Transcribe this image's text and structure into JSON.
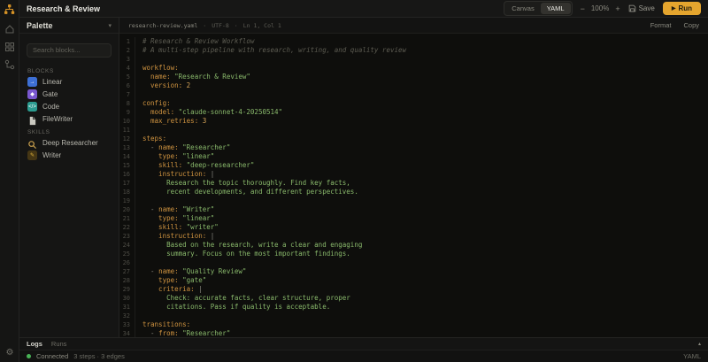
{
  "app": {
    "title": "Research & Review"
  },
  "rail": {
    "icons": [
      "logo-icon",
      "home-icon",
      "blocks-grid-icon",
      "flow-icon",
      "gear-icon"
    ]
  },
  "topbar": {
    "view_canvas": "Canvas",
    "view_yaml": "YAML",
    "active_view": "YAML",
    "zoom_out": "−",
    "zoom_level": "100%",
    "zoom_in": "+",
    "save": "Save",
    "run": "Run"
  },
  "palette": {
    "title": "Palette",
    "search_placeholder": "Search blocks...",
    "sections": [
      {
        "label": "Blocks",
        "items": [
          {
            "label": "Linear",
            "icon": "linear-icon",
            "type": "glyph",
            "glyph": "→",
            "bg": "#3d6fd4",
            "fg": "#ffffff"
          },
          {
            "label": "Gate",
            "icon": "gate-icon",
            "type": "glyph",
            "glyph": "◆",
            "bg": "#7a58cf",
            "fg": "#ffffff"
          },
          {
            "label": "Code",
            "icon": "code-icon",
            "type": "glyph",
            "glyph": "</>",
            "bg": "#2b9b8f",
            "fg": "#ffffff"
          },
          {
            "label": "FileWriter",
            "icon": "file-icon",
            "type": "file",
            "fg": "#c9c8c0"
          }
        ]
      },
      {
        "label": "Skills",
        "items": [
          {
            "label": "Deep Researcher",
            "icon": "magnifier-icon",
            "type": "search",
            "fg": "#c9a04d"
          },
          {
            "label": "Writer",
            "icon": "pencil-icon",
            "type": "glyph",
            "glyph": "✎",
            "bg": "#453614",
            "fg": "#e3b53c"
          }
        ]
      }
    ]
  },
  "editor": {
    "filename": "research-review.yaml",
    "separator": "·",
    "encoding": "UTF-8",
    "cursor": "Ln 1, Col 1",
    "format": "Format",
    "copy": "Copy",
    "lines": [
      [
        [
          "com",
          "# Research & Review Workflow"
        ]
      ],
      [
        [
          "com",
          "# A multi-step pipeline with research, writing, and quality review"
        ]
      ],
      [],
      [
        [
          "key",
          "workflow:"
        ]
      ],
      [
        [
          "key",
          "  name:"
        ],
        [
          "str",
          " \"Research & Review\""
        ]
      ],
      [
        [
          "key",
          "  version:"
        ],
        [
          "num",
          " 2"
        ]
      ],
      [],
      [
        [
          "key",
          "config:"
        ]
      ],
      [
        [
          "key",
          "  model:"
        ],
        [
          "str",
          " \"claude-sonnet-4-20250514\""
        ]
      ],
      [
        [
          "key",
          "  max_retries:"
        ],
        [
          "num",
          " 3"
        ]
      ],
      [],
      [
        [
          "key",
          "steps:"
        ]
      ],
      [
        [
          "pun",
          "  - "
        ],
        [
          "key",
          "name:"
        ],
        [
          "str",
          " \"Researcher\""
        ]
      ],
      [
        [
          "key",
          "    type:"
        ],
        [
          "str",
          " \"linear\""
        ]
      ],
      [
        [
          "key",
          "    skill:"
        ],
        [
          "str",
          " \"deep-researcher\""
        ]
      ],
      [
        [
          "key",
          "    instruction:"
        ],
        [
          "pun",
          " |"
        ]
      ],
      [
        [
          "str",
          "      Research the topic thoroughly. Find key facts,"
        ]
      ],
      [
        [
          "str",
          "      recent developments, and different perspectives."
        ]
      ],
      [],
      [
        [
          "pun",
          "  - "
        ],
        [
          "key",
          "name:"
        ],
        [
          "str",
          " \"Writer\""
        ]
      ],
      [
        [
          "key",
          "    type:"
        ],
        [
          "str",
          " \"linear\""
        ]
      ],
      [
        [
          "key",
          "    skill:"
        ],
        [
          "str",
          " \"writer\""
        ]
      ],
      [
        [
          "key",
          "    instruction:"
        ],
        [
          "pun",
          " |"
        ]
      ],
      [
        [
          "str",
          "      Based on the research, write a clear and engaging"
        ]
      ],
      [
        [
          "str",
          "      summary. Focus on the most important findings."
        ]
      ],
      [],
      [
        [
          "pun",
          "  - "
        ],
        [
          "key",
          "name:"
        ],
        [
          "str",
          " \"Quality Review\""
        ]
      ],
      [
        [
          "key",
          "    type:"
        ],
        [
          "str",
          " \"gate\""
        ]
      ],
      [
        [
          "key",
          "    criteria:"
        ],
        [
          "pun",
          " |"
        ]
      ],
      [
        [
          "str",
          "      Check: accurate facts, clear structure, proper"
        ]
      ],
      [
        [
          "str",
          "      citations. Pass if quality is acceptable."
        ]
      ],
      [],
      [
        [
          "key",
          "transitions:"
        ]
      ],
      [
        [
          "pun",
          "  - "
        ],
        [
          "key",
          "from:"
        ],
        [
          "str",
          " \"Researcher\""
        ]
      ]
    ]
  },
  "bottom": {
    "tab_logs": "Logs",
    "tab_runs": "Runs",
    "active_tab": "Logs",
    "expand_icon": "▴",
    "connection": "Connected",
    "summary": "3 steps · 3 edges",
    "mode": "YAML"
  }
}
